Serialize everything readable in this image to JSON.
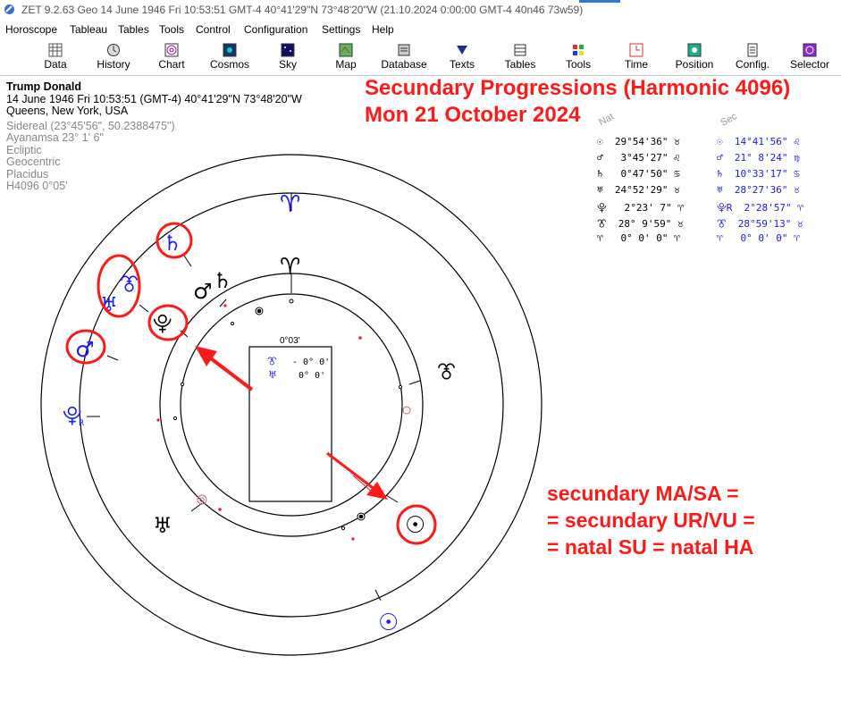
{
  "window": {
    "title": "ZET 9.2.63 Geo    14 June 1946  Fri  10:53:51 GMT-4 40°41'29\"N  73°48'20\"W  (21.10.2024   0:00:00 GMT-4 40n46 73w59)"
  },
  "menu": [
    "Horoscope",
    "Tableau",
    "Tables",
    "Tools",
    "Control",
    "Configuration",
    "Settings",
    "Help"
  ],
  "toolbar": [
    {
      "label": "Data",
      "icon": "data-grid-icon"
    },
    {
      "label": "History",
      "icon": "history-icon"
    },
    {
      "label": "Chart",
      "icon": "chart-wheel-icon"
    },
    {
      "label": "Cosmos",
      "icon": "cosmos-icon"
    },
    {
      "label": "Sky",
      "icon": "sky-icon"
    },
    {
      "label": "Map",
      "icon": "map-icon"
    },
    {
      "label": "Database",
      "icon": "database-icon"
    },
    {
      "label": "Texts",
      "icon": "texts-icon"
    },
    {
      "label": "Tables",
      "icon": "tables-icon"
    },
    {
      "label": "Tools",
      "icon": "tools-icon"
    },
    {
      "label": "Time",
      "icon": "time-icon"
    },
    {
      "label": "Position",
      "icon": "position-icon"
    },
    {
      "label": "Config.",
      "icon": "config-icon"
    },
    {
      "label": "Selector",
      "icon": "selector-icon"
    }
  ],
  "chart_info": {
    "name": "Trump Donald",
    "line1": "14 June 1946  Fri  10:53:51 (GMT-4) 40°41'29\"N  73°48'20\"W",
    "line2": "Queens, New York, USA",
    "sidereal": "Sidereal (23°45'56\", 50.2388475\")",
    "ayanamsa": "Ayanamsa 23° 1' 6\"",
    "ecliptic": "Ecliptic",
    "geocentric": "Geocentric",
    "houses": "Placidus",
    "harmonic": "H4096   0°05'"
  },
  "heading": {
    "line1": "Secundary Progressions (Harmonic 4096)",
    "line2": "Mon 21 October 2024"
  },
  "positions": {
    "nat_header": "Nat",
    "sec_header": "Sec",
    "rows": [
      {
        "glyph": "☉",
        "nat": "29°54'36\" ♉",
        "sec_glyph": "☉",
        "sec": "14°41'56\" ♌"
      },
      {
        "glyph": "♂",
        "nat": " 3°45'27\" ♌",
        "sec_glyph": "♂",
        "sec": "21° 8'24\" ♍"
      },
      {
        "glyph": "♄",
        "nat": " 0°47'50\" ♋",
        "sec_glyph": "♄",
        "sec": "10°33'17\" ♋"
      },
      {
        "glyph": "♅",
        "nat": "24°52'29\" ♉",
        "sec_glyph": "♅",
        "sec": "28°27'36\" ♉"
      },
      {
        "glyph": "⯓",
        "nat": " 2°23' 7\" ♈",
        "sec_glyph": "⯓R",
        "sec": " 2°28'57\" ♈"
      },
      {
        "glyph": "⯔",
        "nat": "28° 9'59\" ♉",
        "sec_glyph": "⯔",
        "sec": "28°59'13\" ♉"
      },
      {
        "glyph": "♈",
        "nat": " 0° 0' 0\" ♈",
        "sec_glyph": "♈",
        "sec": " 0° 0' 0\" ♈"
      }
    ]
  },
  "wheel": {
    "center_label": "0°03'",
    "aspect_box": [
      {
        "glyph": "⯔",
        "value": "- 0° 0'"
      },
      {
        "glyph": "♅",
        "value": "0° 0'"
      }
    ]
  },
  "note": {
    "line1": "secundary MA/SA =",
    "line2": "= secundary UR/VU =",
    "line3": "= natal SU = natal HA"
  },
  "colors": {
    "annotation_red": "#ff1a1a",
    "progressed_blue": "#1a1aff",
    "menu_accent": "#2b79d8"
  }
}
